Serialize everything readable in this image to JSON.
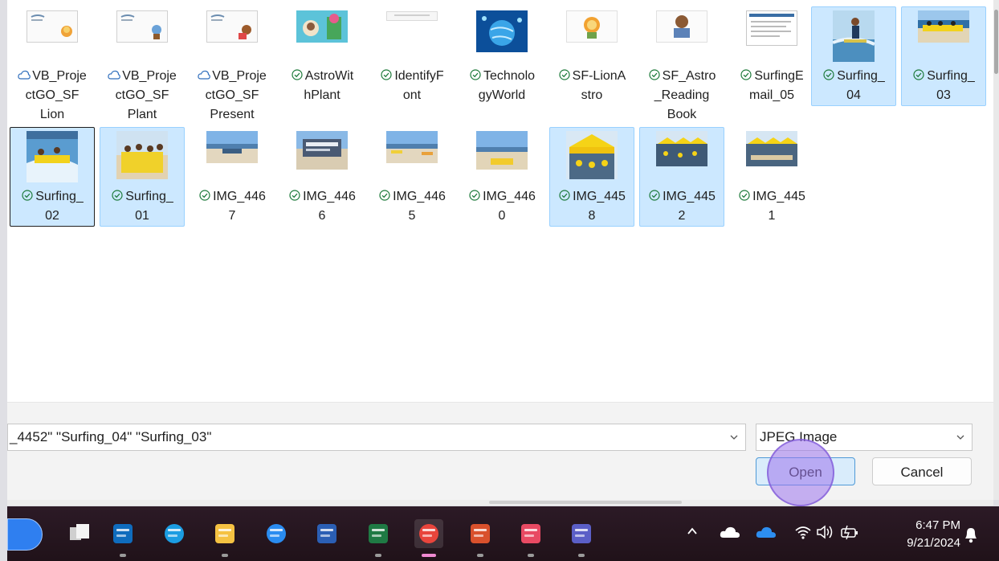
{
  "files": [
    {
      "name": "VB_Proje\nctGO_SF\nLion",
      "status": "cloud",
      "thumb": "doc-lion",
      "selected": false
    },
    {
      "name": "VB_Proje\nctGO_SF\nPlant",
      "status": "cloud",
      "thumb": "doc-plant",
      "selected": false
    },
    {
      "name": "VB_Proje\nctGO_SF\nPresent",
      "status": "cloud",
      "thumb": "doc-present",
      "selected": false
    },
    {
      "name": "AstroWit\nhPlant",
      "status": "synced",
      "thumb": "astro-plant",
      "selected": false
    },
    {
      "name": "IdentifyF\nont",
      "status": "synced",
      "thumb": "blank",
      "selected": false
    },
    {
      "name": "Technolo\ngyWorld",
      "status": "synced",
      "thumb": "globe",
      "selected": false
    },
    {
      "name": "SF-LionA\nstro",
      "status": "synced",
      "thumb": "lion",
      "selected": false
    },
    {
      "name": "SF_Astro\n_Reading\nBook",
      "status": "synced",
      "thumb": "reading",
      "selected": false
    },
    {
      "name": "SurfingE\nmail_05",
      "status": "synced",
      "thumb": "email",
      "selected": false
    },
    {
      "name": "Surfing_\n04",
      "status": "synced",
      "thumb": "surf-wave",
      "selected": true
    },
    {
      "name": "Surfing_\n03",
      "status": "synced",
      "thumb": "surf-beach",
      "selected": true
    },
    {
      "name": "Surfing_\n02",
      "status": "synced",
      "thumb": "surf-water",
      "selected": true,
      "focused": true
    },
    {
      "name": "Surfing_\n01",
      "status": "synced",
      "thumb": "surf-group",
      "selected": true
    },
    {
      "name": "IMG_446\n7",
      "status": "synced",
      "thumb": "beach1",
      "selected": false
    },
    {
      "name": "IMG_446\n6",
      "status": "synced",
      "thumb": "beach-sign",
      "selected": false
    },
    {
      "name": "IMG_446\n5",
      "status": "synced",
      "thumb": "beach2",
      "selected": false
    },
    {
      "name": "IMG_446\n0",
      "status": "synced",
      "thumb": "beach3",
      "selected": false
    },
    {
      "name": "IMG_445\n8",
      "status": "synced",
      "thumb": "tent-large",
      "selected": true
    },
    {
      "name": "IMG_445\n2",
      "status": "synced",
      "thumb": "tents",
      "selected": true
    },
    {
      "name": "IMG_445\n1",
      "status": "synced",
      "thumb": "tents2",
      "selected": false
    }
  ],
  "filename_value": "_4452\" \"Surfing_04\" \"Surfing_03\"",
  "filetype_value": "JPEG Image",
  "open_label": "Open",
  "cancel_label": "Cancel",
  "taskbar_apps": [
    {
      "name": "outlook-icon",
      "color": "#0f6cbd",
      "running": true
    },
    {
      "name": "edge-icon",
      "color": "#1b9de2",
      "running": false
    },
    {
      "name": "file-explorer-icon",
      "color": "#f5c242",
      "running": true
    },
    {
      "name": "system-tool-icon",
      "color": "#2a8cf0",
      "running": false
    },
    {
      "name": "word-icon",
      "color": "#2b5fb4",
      "running": false
    },
    {
      "name": "excel-icon",
      "color": "#1f7a44",
      "running": true
    },
    {
      "name": "chrome-icon",
      "color": "#e8453c",
      "running": true,
      "active": true
    },
    {
      "name": "powerpoint-icon",
      "color": "#d9512c",
      "running": true
    },
    {
      "name": "scribe-icon",
      "color": "#e84a63",
      "running": true
    },
    {
      "name": "teams-icon",
      "color": "#5b5fc7",
      "running": true
    }
  ],
  "clock_time": "6:47 PM",
  "clock_date": "9/21/2024"
}
